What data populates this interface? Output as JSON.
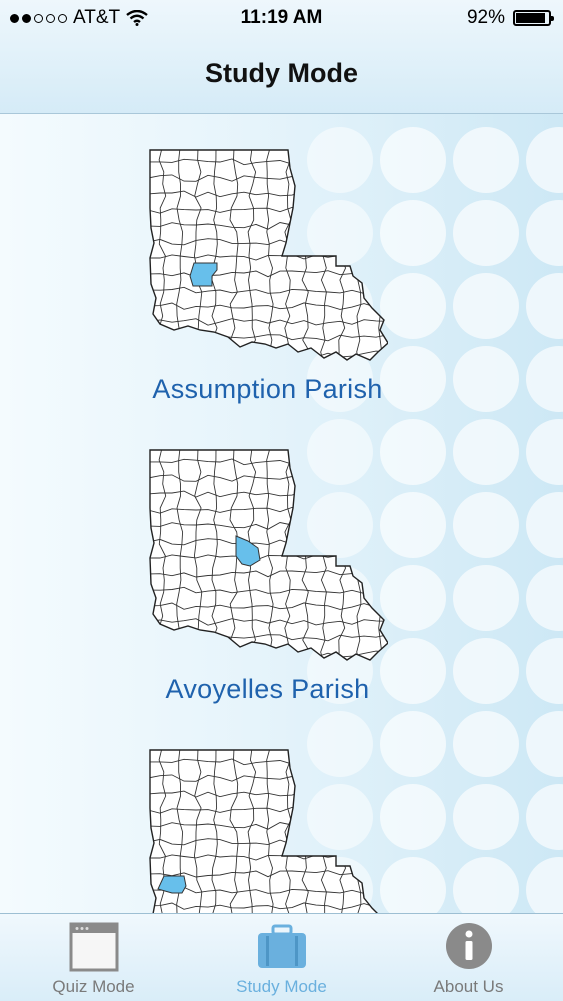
{
  "status_bar": {
    "carrier": "AT&T",
    "time": "11:19 AM",
    "battery_percent": "92%",
    "battery_level": 0.92,
    "signal_bars_filled": 2,
    "signal_bars_total": 5
  },
  "nav": {
    "title": "Study Mode"
  },
  "parishes": [
    {
      "label": "Assumption Parish",
      "highlight_color": "#67bfeb",
      "icon": "louisiana-map-icon"
    },
    {
      "label": "Avoyelles Parish",
      "highlight_color": "#67bfeb",
      "icon": "louisiana-map-icon"
    },
    {
      "label": "",
      "highlight_color": "#67bfeb",
      "icon": "louisiana-map-icon"
    }
  ],
  "tabs": [
    {
      "label": "Quiz Mode",
      "icon": "window-icon",
      "active": false
    },
    {
      "label": "Study Mode",
      "icon": "briefcase-icon",
      "active": true
    },
    {
      "label": "About Us",
      "icon": "info-icon",
      "active": false
    }
  ],
  "colors": {
    "label_blue": "#1f62ad",
    "active_tab": "#6ab0de",
    "inactive_tab": "#7a7a7a"
  }
}
